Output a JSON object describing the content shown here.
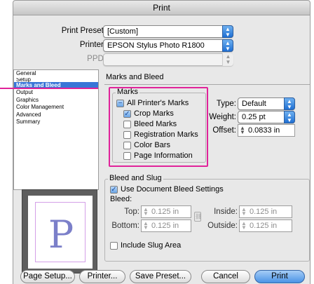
{
  "window": {
    "title": "Print"
  },
  "header": {
    "preset_label": "Print Preset:",
    "preset_value": "[Custom]",
    "printer_label": "Printer:",
    "printer_value": "EPSON Stylus Photo R1800",
    "ppd_label": "PPD:",
    "ppd_value": ""
  },
  "sidebar": {
    "items": [
      {
        "label": "General"
      },
      {
        "label": "Setup"
      },
      {
        "label": "Marks and Bleed"
      },
      {
        "label": "Output"
      },
      {
        "label": "Graphics"
      },
      {
        "label": "Color Management"
      },
      {
        "label": "Advanced"
      },
      {
        "label": "Summary"
      }
    ],
    "selected": "Marks and Bleed"
  },
  "panel": {
    "title": "Marks and Bleed",
    "marks": {
      "group_label": "Marks",
      "all_marks": "All Printer's Marks",
      "crop_marks": "Crop Marks",
      "bleed_marks": "Bleed Marks",
      "registration_marks": "Registration Marks",
      "color_bars": "Color Bars",
      "page_information": "Page Information",
      "type_label": "Type:",
      "type_value": "Default",
      "weight_label": "Weight:",
      "weight_value": "0.25 pt",
      "offset_label": "Offset:",
      "offset_value": "0.0833 in"
    },
    "bleed": {
      "group_label": "Bleed and Slug",
      "use_doc_settings": "Use Document Bleed Settings",
      "bleed_label": "Bleed:",
      "top_label": "Top:",
      "top_value": "0.125 in",
      "bottom_label": "Bottom:",
      "bottom_value": "0.125 in",
      "inside_label": "Inside:",
      "inside_value": "0.125 in",
      "outside_label": "Outside:",
      "outside_value": "0.125 in",
      "include_slug": "Include Slug Area"
    }
  },
  "preview": {
    "glyph": "P"
  },
  "buttons": {
    "page_setup": "Page Setup...",
    "printer": "Printer...",
    "save_preset": "Save Preset...",
    "cancel": "Cancel",
    "print": "Print"
  },
  "colors": {
    "highlight": "#e0239a",
    "selection": "#3875d7",
    "accent": "#4a93e6"
  }
}
